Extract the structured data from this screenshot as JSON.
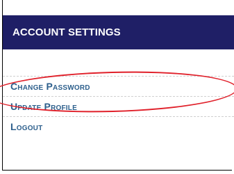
{
  "header": {
    "title": "ACCOUNT SETTINGS"
  },
  "menu": {
    "items": [
      {
        "label": "Change Password"
      },
      {
        "label": "Update Profile"
      },
      {
        "label": "Logout"
      }
    ]
  },
  "colors": {
    "header_bg": "#1f1f66",
    "link": "#2d5f8c",
    "annotation": "#e0202a"
  }
}
